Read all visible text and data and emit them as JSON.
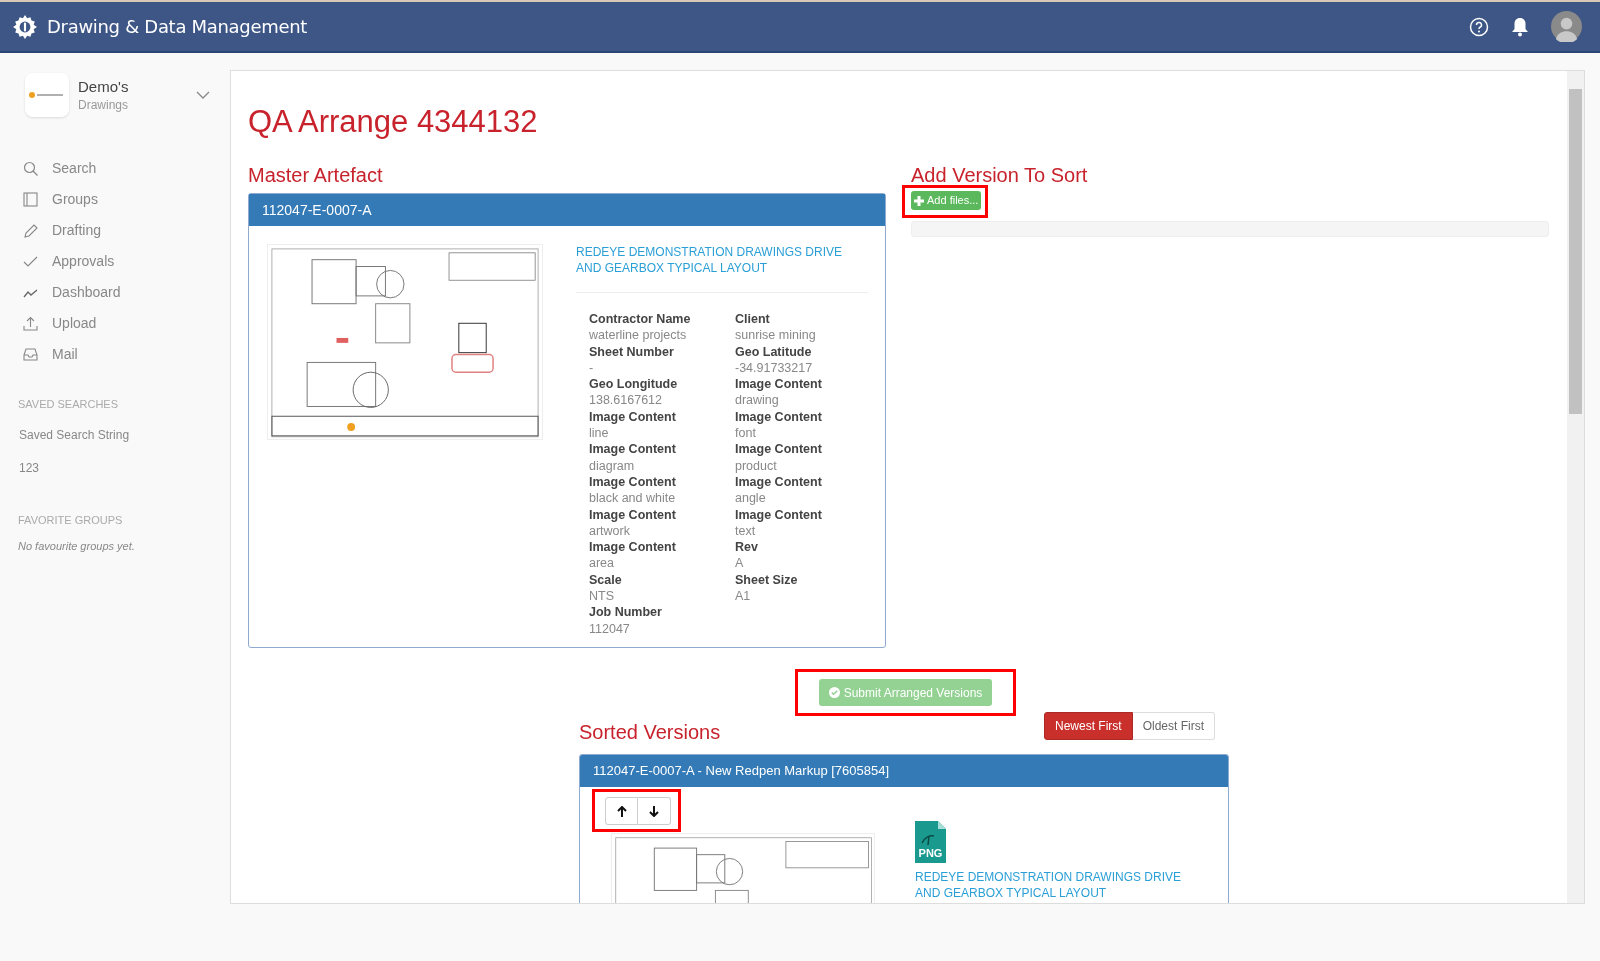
{
  "app_title": "Drawing & Data Management",
  "account": {
    "name": "Demo's",
    "subtitle": "Drawings"
  },
  "nav": [
    {
      "label": "Search",
      "kind": "search"
    },
    {
      "label": "Groups",
      "kind": "groups"
    },
    {
      "label": "Drafting",
      "kind": "pencil"
    },
    {
      "label": "Approvals",
      "kind": "check"
    },
    {
      "label": "Dashboard",
      "kind": "chart"
    },
    {
      "label": "Upload",
      "kind": "upload"
    },
    {
      "label": "Mail",
      "kind": "inbox"
    }
  ],
  "saved_searches": {
    "heading": "SAVED SEARCHES",
    "items": [
      "Saved Search String",
      "123"
    ]
  },
  "favorite_groups": {
    "heading": "FAVORITE GROUPS",
    "empty": "No favourite groups yet."
  },
  "page_title": "QA Arrange 4344132",
  "master": {
    "heading": "Master Artefact",
    "card_title": "112047-E-0007-A",
    "link": "REDEYE DEMONSTRATION DRAWINGS DRIVE AND GEARBOX TYPICAL LAYOUT",
    "fields": [
      {
        "label": "Contractor Name",
        "value": "waterline projects"
      },
      {
        "label": "Client",
        "value": "sunrise mining"
      },
      {
        "label": "Sheet Number",
        "value": "-"
      },
      {
        "label": "Geo Latitude",
        "value": "-34.91733217"
      },
      {
        "label": "Geo Longitude",
        "value": "138.6167612"
      },
      {
        "label": "Image Content",
        "value": "drawing"
      },
      {
        "label": "Image Content",
        "value": "line"
      },
      {
        "label": "Image Content",
        "value": "font"
      },
      {
        "label": "Image Content",
        "value": "diagram"
      },
      {
        "label": "Image Content",
        "value": "product"
      },
      {
        "label": "Image Content",
        "value": "black and white"
      },
      {
        "label": "Image Content",
        "value": "angle"
      },
      {
        "label": "Image Content",
        "value": "artwork"
      },
      {
        "label": "Image Content",
        "value": "text"
      },
      {
        "label": "Image Content",
        "value": "area"
      },
      {
        "label": "Rev",
        "value": "A"
      },
      {
        "label": "Scale",
        "value": "NTS"
      },
      {
        "label": "Sheet Size",
        "value": "A1"
      },
      {
        "label": "Job Number",
        "value": "112047"
      }
    ]
  },
  "add_version": {
    "heading": "Add Version To Sort",
    "button": "Add files...",
    "progress": {
      "level": 0
    }
  },
  "submit_button": "Submit Arranged Versions",
  "sort_options": [
    {
      "label": "Newest First",
      "selected": true
    },
    {
      "label": "Oldest First",
      "selected": false
    }
  ],
  "sorted": {
    "heading": "Sorted Versions",
    "versions": [
      {
        "title": "112047-E-0007-A - New Redpen Markup [7605854]",
        "file_type": "PNG",
        "link": "REDEYE DEMONSTRATION DRAWINGS DRIVE AND GEARBOX TYPICAL LAYOUT"
      }
    ]
  }
}
